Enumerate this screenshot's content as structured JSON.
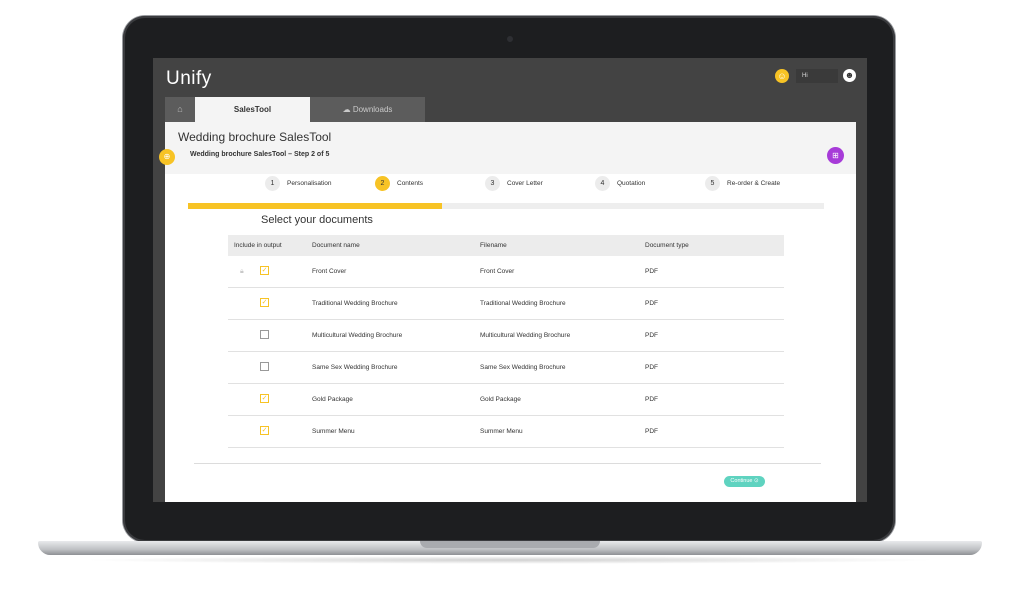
{
  "header": {
    "logo": "Unify",
    "user_initial": "☺",
    "greeting": "Hi",
    "avatar_icon": "☻"
  },
  "tabs": {
    "home_icon": "⌂",
    "active": "SalesTool",
    "downloads": "Downloads",
    "downloads_icon": "☁"
  },
  "page": {
    "title": "Wedding brochure SalesTool",
    "step_title": "Wedding brochure SalesTool – Step 2 of 5",
    "side_icon": "⊕",
    "gift_icon": "⊞"
  },
  "steps": [
    {
      "num": "1",
      "label": "Personalisation"
    },
    {
      "num": "2",
      "label": "Contents"
    },
    {
      "num": "3",
      "label": "Cover Letter"
    },
    {
      "num": "4",
      "label": "Quotation"
    },
    {
      "num": "5",
      "label": "Re-order & Create"
    }
  ],
  "progress": {
    "fraction": 0.4,
    "current_step": 2
  },
  "section_title": "Select your documents",
  "table": {
    "headers": [
      "Include in output",
      "Document name",
      "Filename",
      "Document type"
    ],
    "rows": [
      {
        "name": "Front Cover",
        "filename": "Front Cover",
        "type": "PDF",
        "included": true,
        "locked": true
      },
      {
        "name": "Traditional Wedding Brochure",
        "filename": "Traditional Wedding Brochure",
        "type": "PDF",
        "included": true,
        "locked": false
      },
      {
        "name": "Multicultural Wedding Brochure",
        "filename": "Multicultural Wedding Brochure",
        "type": "PDF",
        "included": false,
        "locked": false
      },
      {
        "name": "Same Sex Wedding Brochure",
        "filename": "Same Sex Wedding Brochure",
        "type": "PDF",
        "included": false,
        "locked": false
      },
      {
        "name": "Gold Package",
        "filename": "Gold Package",
        "type": "PDF",
        "included": true,
        "locked": false
      },
      {
        "name": "Summer Menu",
        "filename": "Summer Menu",
        "type": "PDF",
        "included": true,
        "locked": false
      }
    ]
  },
  "continue_label": "Continue ⊙",
  "colors": {
    "accent": "#f7c325",
    "continue": "#5fd3c0",
    "gift": "#a73bd8",
    "chrome": "#434343"
  }
}
